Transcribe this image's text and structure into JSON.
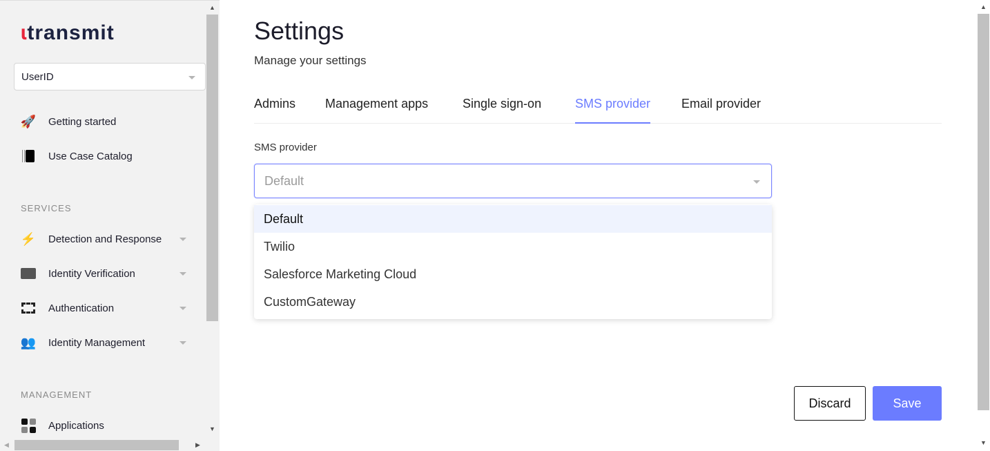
{
  "sidebar": {
    "logo": "transmit",
    "app_select": "UserID",
    "items": [
      {
        "label": "Getting started",
        "icon": "rocket-icon"
      },
      {
        "label": "Use Case Catalog",
        "icon": "catalog-icon"
      }
    ],
    "services_heading": "SERVICES",
    "services": [
      {
        "label": "Detection and Response",
        "icon": "bolt-icon"
      },
      {
        "label": "Identity Verification",
        "icon": "id-card-icon"
      },
      {
        "label": "Authentication",
        "icon": "scan-frame-icon"
      },
      {
        "label": "Identity Management",
        "icon": "users-gear-icon"
      }
    ],
    "management_heading": "MANAGEMENT",
    "management": [
      {
        "label": "Applications",
        "icon": "apps-grid-icon"
      }
    ]
  },
  "header": {
    "title": "Settings",
    "subtitle": "Manage your settings"
  },
  "tabs": [
    {
      "label": "Admins"
    },
    {
      "label": "Management apps"
    },
    {
      "label": "Single sign-on"
    },
    {
      "label": "SMS provider",
      "active": true
    },
    {
      "label": "Email provider"
    }
  ],
  "form": {
    "label": "SMS provider",
    "placeholder": "Default",
    "options": [
      "Default",
      "Twilio",
      "Salesforce Marketing Cloud",
      "CustomGateway"
    ]
  },
  "actions": {
    "discard": "Discard",
    "save": "Save"
  },
  "colors": {
    "accent": "#6b7cff",
    "brand_red": "#e8263b"
  }
}
